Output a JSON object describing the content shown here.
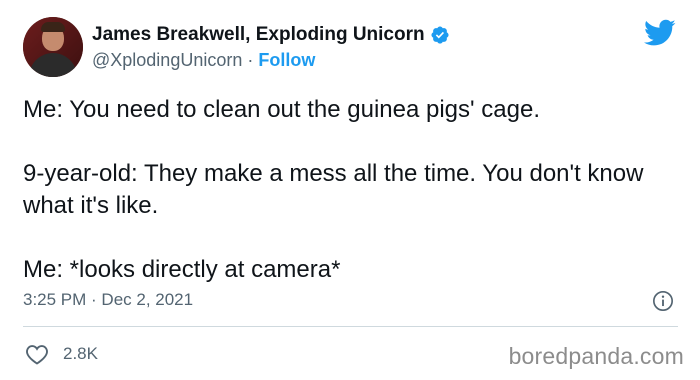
{
  "author": {
    "display_name": "James Breakwell, Exploding Unicorn",
    "handle": "@XplodingUnicorn",
    "separator": "·",
    "follow_label": "Follow",
    "verified": true
  },
  "tweet": {
    "lines": [
      "Me: You need to clean out the guinea pigs' cage.",
      "9-year-old: They make a mess all the time. You don't know what it's like.",
      "Me: *looks directly at camera*"
    ],
    "timestamp": "3:25 PM · Dec 2, 2021"
  },
  "engagement": {
    "like_count": "2.8K"
  },
  "watermark": "boredpanda.com",
  "icons": {
    "brand": "twitter-bird-icon",
    "verified": "verified-badge-icon",
    "info": "info-icon",
    "like": "heart-icon"
  },
  "colors": {
    "accent": "#1d9bf0",
    "text": "#0f1419",
    "secondary_text": "#536471",
    "divider": "#cfd9de",
    "watermark": "#8c8c8c"
  }
}
